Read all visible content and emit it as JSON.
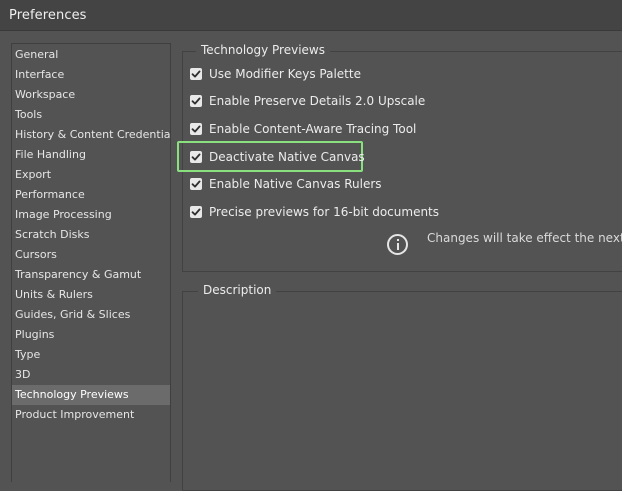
{
  "window": {
    "title": "Preferences"
  },
  "sidebar": {
    "items": [
      {
        "label": "General",
        "selected": false
      },
      {
        "label": "Interface",
        "selected": false
      },
      {
        "label": "Workspace",
        "selected": false
      },
      {
        "label": "Tools",
        "selected": false
      },
      {
        "label": "History & Content Credentials",
        "selected": false
      },
      {
        "label": "File Handling",
        "selected": false
      },
      {
        "label": "Export",
        "selected": false
      },
      {
        "label": "Performance",
        "selected": false
      },
      {
        "label": "Image Processing",
        "selected": false
      },
      {
        "label": "Scratch Disks",
        "selected": false
      },
      {
        "label": "Cursors",
        "selected": false
      },
      {
        "label": "Transparency & Gamut",
        "selected": false
      },
      {
        "label": "Units & Rulers",
        "selected": false
      },
      {
        "label": "Guides, Grid & Slices",
        "selected": false
      },
      {
        "label": "Plugins",
        "selected": false
      },
      {
        "label": "Type",
        "selected": false
      },
      {
        "label": "3D",
        "selected": false
      },
      {
        "label": "Technology Previews",
        "selected": true
      },
      {
        "label": "Product Improvement",
        "selected": false
      }
    ]
  },
  "technology_previews": {
    "legend": "Technology Previews",
    "options": [
      {
        "label": "Use Modifier Keys Palette",
        "checked": true
      },
      {
        "label": "Enable Preserve Details 2.0 Upscale",
        "checked": true
      },
      {
        "label": "Enable Content-Aware Tracing Tool",
        "checked": true
      },
      {
        "label": "Deactivate Native Canvas",
        "checked": true
      },
      {
        "label": "Enable Native Canvas Rulers",
        "checked": true
      },
      {
        "label": "Precise previews for 16-bit documents",
        "checked": true
      }
    ],
    "info": {
      "icon": "info-icon",
      "text": "Changes will take effect the next tim"
    }
  },
  "description": {
    "legend": "Description"
  },
  "colors": {
    "background": "#535353",
    "titlebar": "#444444",
    "selected_item": "#6b6b6b",
    "highlight_border": "#8ae07f",
    "checkbox_fill": "#e8e8e8"
  }
}
